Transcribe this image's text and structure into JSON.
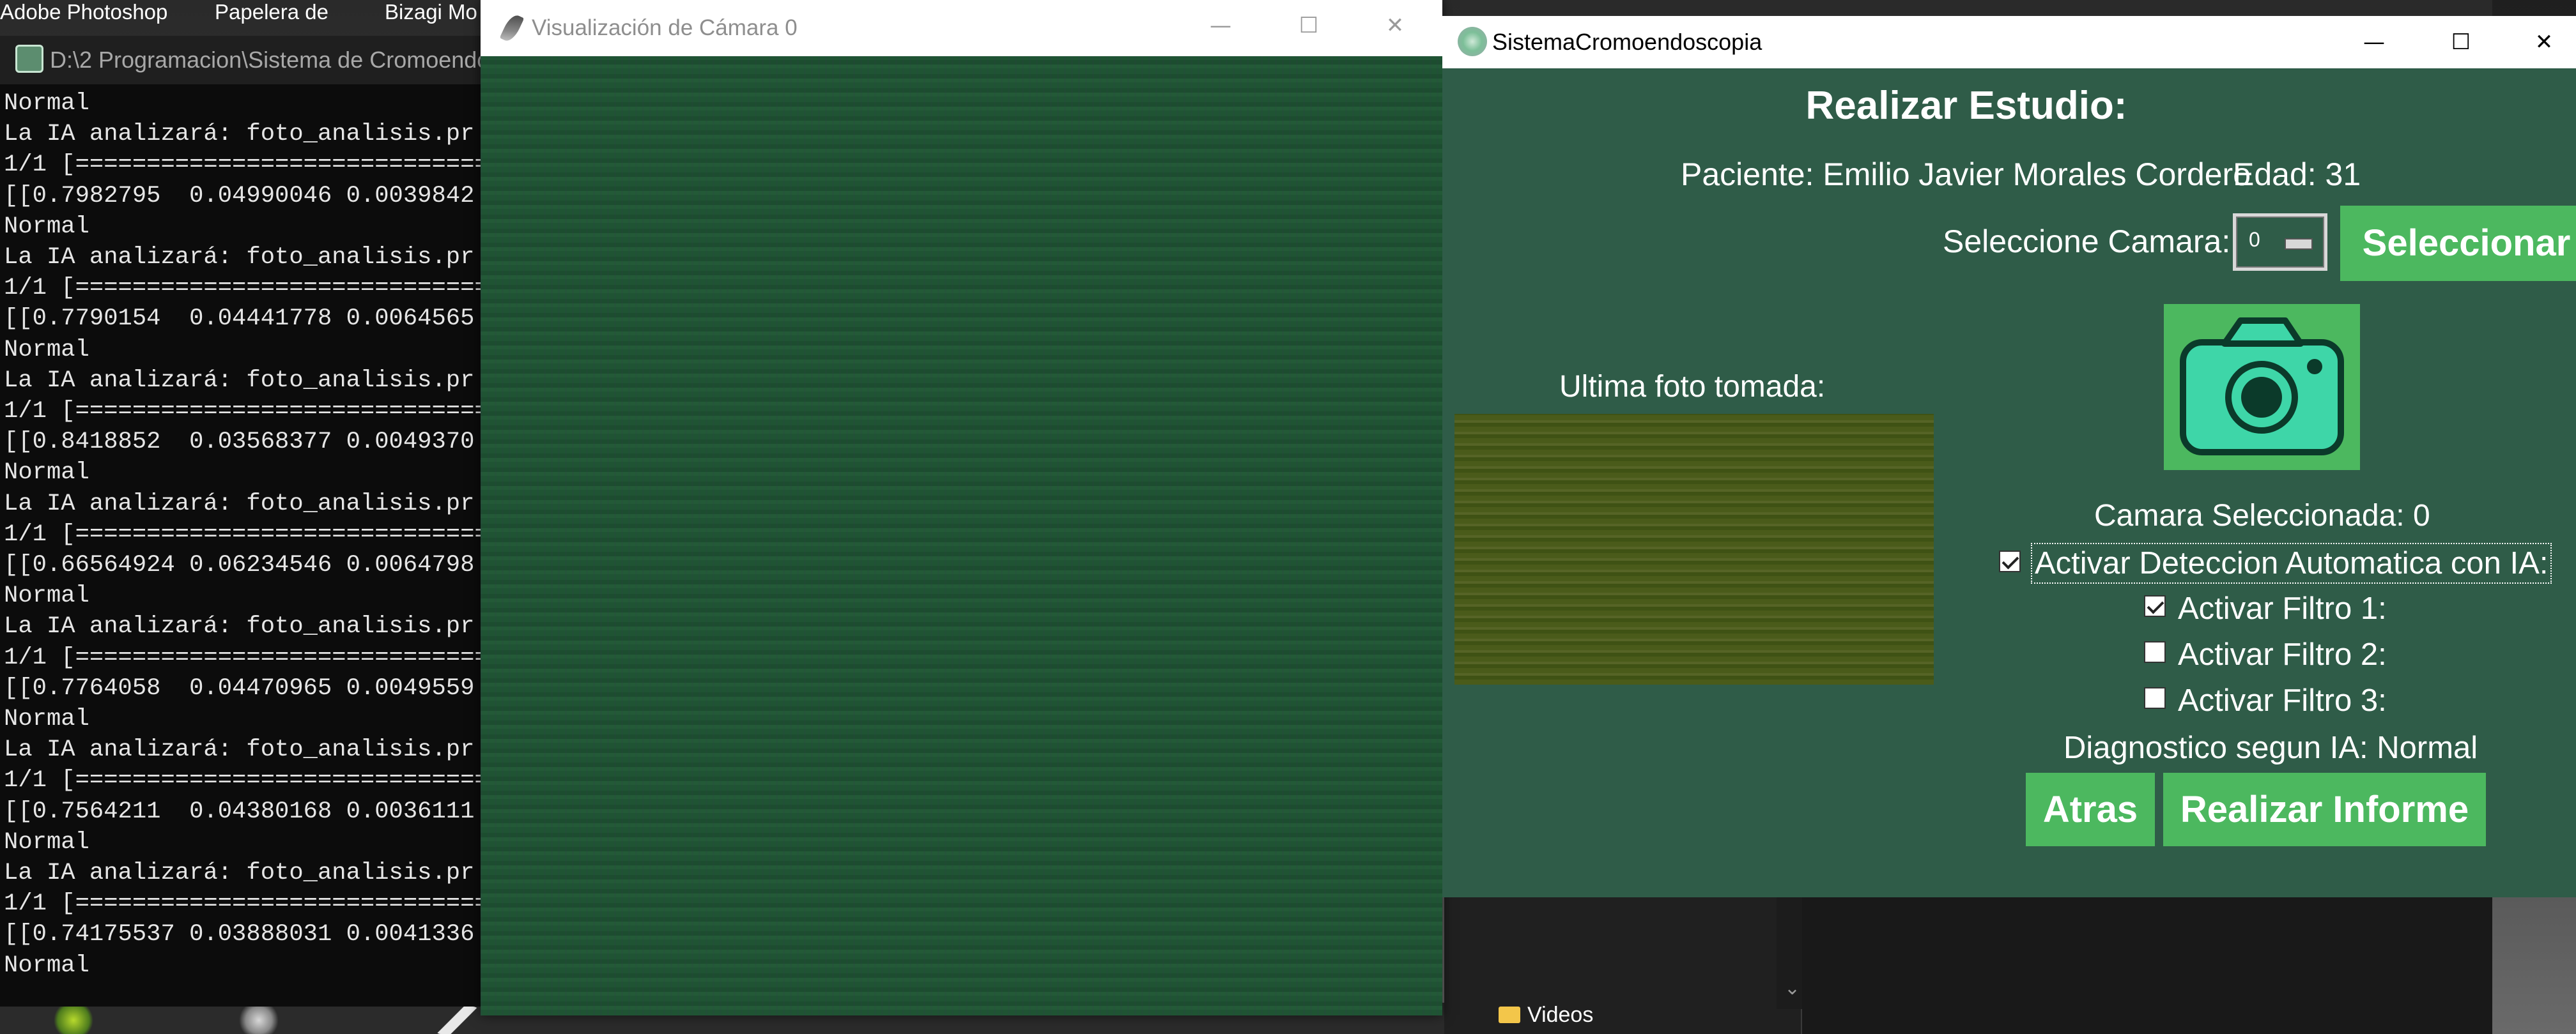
{
  "desktop": {
    "icons": [
      "Adobe Photoshop",
      "Papelera de",
      "Bizagi Mo"
    ]
  },
  "explorer": {
    "videos_label": "Videos"
  },
  "console": {
    "title": "D:\\2 Programacion\\Sistema de Cromoendo",
    "lines": [
      "Normal",
      "La IA analizará: foto_analisis.pr",
      "1/1 [=============================",
      "[[0.7982795  0.04990046 0.0039842",
      "Normal",
      "La IA analizará: foto_analisis.pr",
      "1/1 [=============================",
      "[[0.7790154  0.04441778 0.0064565",
      "Normal",
      "La IA analizará: foto_analisis.pr",
      "1/1 [=============================",
      "[[0.8418852  0.03568377 0.0049370",
      "Normal",
      "La IA analizará: foto_analisis.pr",
      "1/1 [=============================",
      "[[0.66564924 0.06234546 0.0064798",
      "Normal",
      "La IA analizará: foto_analisis.pr",
      "1/1 [=============================",
      "[[0.7764058  0.04470965 0.0049559",
      "Normal",
      "La IA analizará: foto_analisis.pr",
      "1/1 [=============================",
      "[[0.7564211  0.04380168 0.0036111",
      "Normal",
      "La IA analizará: foto_analisis.pr",
      "1/1 [=============================",
      "[[0.74175537 0.03888031 0.0041336",
      "Normal"
    ]
  },
  "camera_window": {
    "title": "Visualización de Cámara 0"
  },
  "app": {
    "title": "SistemaCromoendoscopia",
    "heading": "Realizar Estudio:",
    "patient": "Paciente: Emilio Javier Morales Cordero",
    "age": "Edad: 31",
    "select_camera_label": "Seleccione Camara:",
    "camera_value": "0",
    "select_button": "Seleccionar",
    "last_photo_label": "Ultima foto tomada:",
    "camera_selected": "Camara Seleccionada: 0",
    "ia_detection_label": "Activar Deteccion Automatica con IA:",
    "ia_detection_checked": true,
    "filter1_label": "Activar Filtro 1:",
    "filter1_checked": true,
    "filter2_label": "Activar Filtro 2:",
    "filter2_checked": false,
    "filter3_label": "Activar Filtro 3:",
    "filter3_checked": false,
    "diagnosis": "Diagnostico segun IA: Normal",
    "back_button": "Atras",
    "report_button": "Realizar Informe",
    "accent_color": "#4cb85f",
    "background_color": "#2f5c48"
  }
}
